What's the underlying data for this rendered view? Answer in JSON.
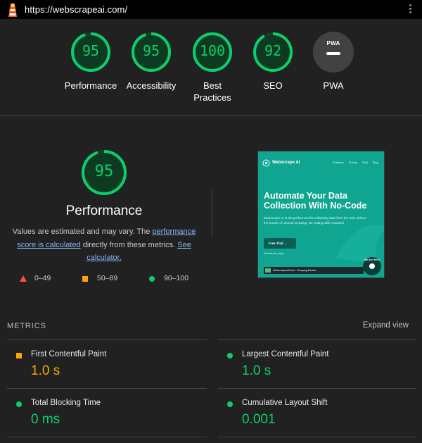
{
  "browser": {
    "url": "https://webscrapeai.com/",
    "menu_icon": "kebab-icon",
    "site_icon": "lighthouse-icon"
  },
  "colors": {
    "pass": "#0cce6b",
    "average": "#ffa400",
    "fail": "#ff4e42",
    "background": "#212121"
  },
  "scores": [
    {
      "label": "Performance",
      "value": "95",
      "fraction": 0.95
    },
    {
      "label": "Accessibility",
      "value": "95",
      "fraction": 0.95
    },
    {
      "label": "Best Practices",
      "value": "100",
      "fraction": 1.0
    },
    {
      "label": "SEO",
      "value": "92",
      "fraction": 0.92
    },
    {
      "label": "PWA",
      "value": "",
      "badge_text": "PWA"
    }
  ],
  "performance": {
    "score": "95",
    "fraction": 0.95,
    "title": "Performance",
    "desc_pre": "Values are estimated and may vary. The ",
    "desc_link": "performance score is calculated",
    "desc_mid": " directly from these metrics. ",
    "desc_calc": "See calculator."
  },
  "legend": [
    {
      "range": "0–49",
      "shape": "triangle"
    },
    {
      "range": "50–89",
      "shape": "square"
    },
    {
      "range": "90–100",
      "shape": "circle"
    }
  ],
  "screenshot": {
    "brand": "Webscrape AI",
    "nav": [
      "Features",
      "Pricing",
      "FAQ",
      "Blog"
    ],
    "headline": "Automate Your Data Collection With No-Code",
    "subtext": "Webscrape AI is the perfect tool for collecting data from the web without the hassle of manual scraping. No coding skills required",
    "cta": "Free Trial →",
    "powered": "Powered by stripe",
    "video_title": "Webscrapeai Demo - Scraping Movies",
    "badge_text": "We Are Here!"
  },
  "metrics": {
    "header": "METRICS",
    "expand_label": "Expand view",
    "items": [
      {
        "label": "First Contentful Paint",
        "value": "1.0 s",
        "status": "average"
      },
      {
        "label": "Largest Contentful Paint",
        "value": "1.0 s",
        "status": "pass"
      },
      {
        "label": "Total Blocking Time",
        "value": "0 ms",
        "status": "pass"
      },
      {
        "label": "Cumulative Layout Shift",
        "value": "0.001",
        "status": "pass"
      }
    ]
  }
}
